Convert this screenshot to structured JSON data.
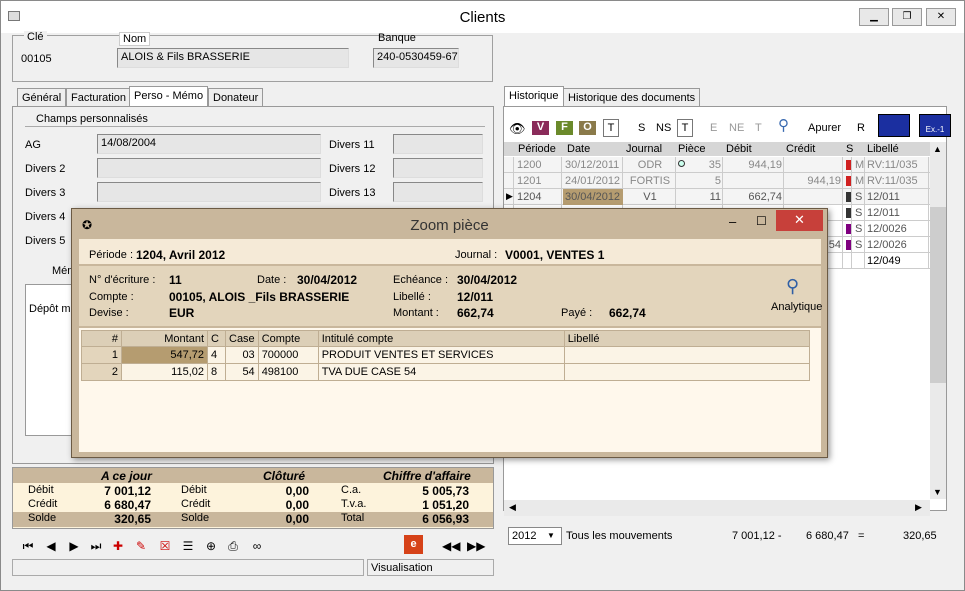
{
  "window": {
    "title": "Clients"
  },
  "client": {
    "cle_label": "Clé",
    "cle": "00105",
    "nom_label": "Nom",
    "nom": "ALOIS & Fils BRASSERIE",
    "banque_label": "Banque",
    "banque": "240-0530459-67"
  },
  "left_tabs": [
    "Général",
    "Facturation",
    "Perso - Mémo",
    "Donateur"
  ],
  "perso": {
    "group_label": "Champs personnalisés",
    "fields": [
      {
        "label": "AG",
        "value": "14/08/2004"
      },
      {
        "label": "Divers 2",
        "value": ""
      },
      {
        "label": "Divers 3",
        "value": ""
      },
      {
        "label": "Divers 4",
        "value": ""
      },
      {
        "label": "Divers 5",
        "value": ""
      }
    ],
    "right_fields": [
      {
        "label": "Divers 11",
        "value": ""
      },
      {
        "label": "Divers 12",
        "value": ""
      },
      {
        "label": "Divers 13",
        "value": ""
      }
    ],
    "memo_label": "Mém",
    "memo_text": "Dépôt ma"
  },
  "summary": {
    "headers": [
      "A ce jour",
      "Clôturé",
      "Chiffre d'affaire"
    ],
    "rows": [
      {
        "l1": "Débit",
        "v1": "7 001,12",
        "l2": "Débit",
        "v2": "0,00",
        "l3": "C.a.",
        "v3": "5 005,73"
      },
      {
        "l1": "Crédit",
        "v1": "6 680,47",
        "l2": "Crédit",
        "v2": "0,00",
        "l3": "T.v.a.",
        "v3": "1 051,20"
      },
      {
        "l1": "Solde",
        "v1": "320,65",
        "l2": "Solde",
        "v2": "0,00",
        "l3": "Total",
        "v3": "6 056,93"
      }
    ]
  },
  "status": {
    "mode": "Visualisation"
  },
  "right_tabs": [
    "Historique",
    "Historique des documents"
  ],
  "hist_toolbar": {
    "letters": [
      "V",
      "F",
      "O",
      "T"
    ],
    "filters": [
      "S",
      "NS",
      "T",
      "E",
      "NE",
      "T"
    ],
    "apurer": "Apurer",
    "r": "R",
    "ex": "Ex.-1"
  },
  "history": {
    "headers": [
      "Période",
      "Date",
      "Journal",
      "Pièce",
      "Débit",
      "Crédit",
      "S",
      "",
      "Libellé"
    ],
    "rows": [
      {
        "periode": "1200",
        "date": "30/12/2011",
        "journal": "ODR",
        "piece": "35",
        "debit": "944,19",
        "credit": "",
        "s": "M",
        "lib": "RV:11/035"
      },
      {
        "periode": "1201",
        "date": "24/01/2012",
        "journal": "FORTIS",
        "piece": "5",
        "debit": "",
        "credit": "944,19",
        "s": "M",
        "lib": "RV:11/035"
      },
      {
        "periode": "1204",
        "date": "30/04/2012",
        "journal": "V1",
        "piece": "11",
        "debit": "662,74",
        "credit": "",
        "s": "S",
        "lib": "12/011"
      },
      {
        "periode": "",
        "date": "",
        "journal": "",
        "piece": "",
        "debit": "",
        "credit": "",
        "s": "S",
        "lib": "12/011"
      },
      {
        "periode": "",
        "date": "",
        "journal": "",
        "piece": "",
        "debit": "",
        "credit": "",
        "s": "S",
        "lib": "12/0026"
      },
      {
        "periode": "",
        "date": "",
        "journal": "",
        "piece": "",
        "debit": "",
        "credit": "54",
        "s": "S",
        "lib": "12/0026"
      },
      {
        "periode": "",
        "date": "",
        "journal": "",
        "piece": "",
        "debit": "",
        "credit": "",
        "s": "",
        "lib": "12/049"
      }
    ]
  },
  "footer": {
    "year": "2012",
    "mode": "Tous les mouvements",
    "debit": "7 001,12 -",
    "credit": "6 680,47",
    "eq": "=",
    "solde": "320,65"
  },
  "zoom": {
    "title": "Zoom pièce",
    "periode_label": "Période :",
    "periode": "1204, Avril 2012",
    "journal_label": "Journal :",
    "journal": "V0001, VENTES 1",
    "ecriture_label": "N° d'écriture :",
    "ecriture": "11",
    "date_label": "Date :",
    "date": "30/04/2012",
    "echeance_label": "Echéance :",
    "echeance": "30/04/2012",
    "compte_label": "Compte :",
    "compte": "00105, ALOIS _Fils BRASSERIE",
    "libelle_label": "Libellé :",
    "libelle": "12/011",
    "devise_label": "Devise :",
    "devise": "EUR",
    "montant_label": "Montant :",
    "montant": "662,74",
    "paye_label": "Payé :",
    "paye": "662,74",
    "analytique": "Analytique",
    "headers": [
      "#",
      "Montant",
      "C",
      "Case",
      "Compte",
      "Intitulé compte",
      "Libellé"
    ],
    "rows": [
      {
        "n": "1",
        "montant": "547,72",
        "c": "4",
        "case": "03",
        "compte": "700000",
        "intitule": "PRODUIT VENTES ET SERVICES",
        "libelle": ""
      },
      {
        "n": "2",
        "montant": "115,02",
        "c": "8",
        "case": "54",
        "compte": "498100",
        "intitule": "TVA DUE CASE 54",
        "libelle": ""
      }
    ]
  },
  "colors": {
    "dialog": "#c9b79c",
    "summary_header": "#c9b79c",
    "summary_body": "#fdf3dc",
    "history_header": "#d6d6d6"
  }
}
